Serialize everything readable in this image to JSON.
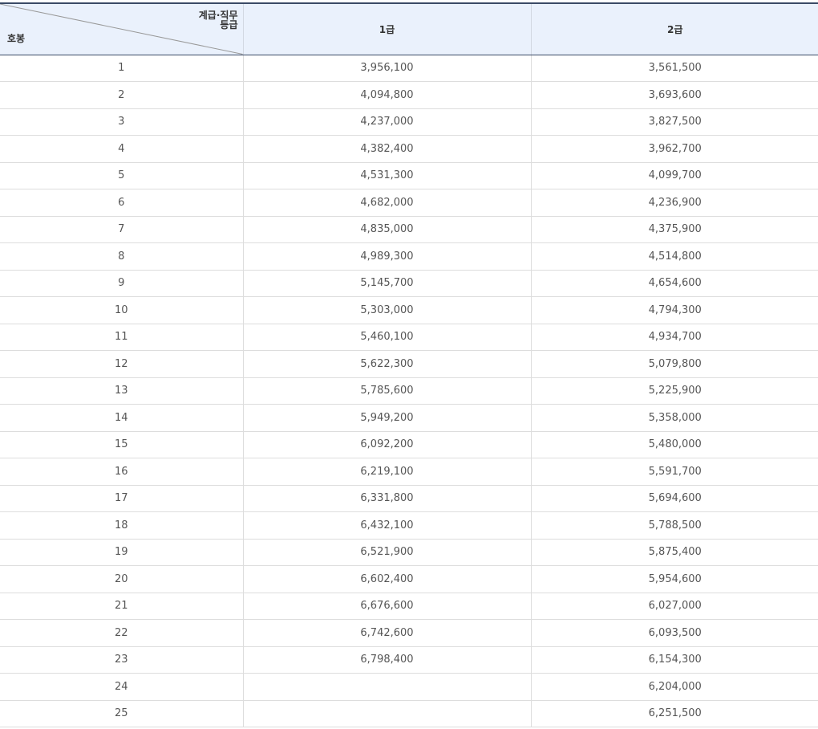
{
  "header": {
    "corner_top_line1": "계급·직무",
    "corner_top_line2": "등급",
    "corner_bottom": "호봉",
    "columns": [
      "1급",
      "2급"
    ]
  },
  "rows": [
    {
      "step": "1",
      "grade1": "3,956,100",
      "grade2": "3,561,500"
    },
    {
      "step": "2",
      "grade1": "4,094,800",
      "grade2": "3,693,600"
    },
    {
      "step": "3",
      "grade1": "4,237,000",
      "grade2": "3,827,500"
    },
    {
      "step": "4",
      "grade1": "4,382,400",
      "grade2": "3,962,700"
    },
    {
      "step": "5",
      "grade1": "4,531,300",
      "grade2": "4,099,700"
    },
    {
      "step": "6",
      "grade1": "4,682,000",
      "grade2": "4,236,900"
    },
    {
      "step": "7",
      "grade1": "4,835,000",
      "grade2": "4,375,900"
    },
    {
      "step": "8",
      "grade1": "4,989,300",
      "grade2": "4,514,800"
    },
    {
      "step": "9",
      "grade1": "5,145,700",
      "grade2": "4,654,600"
    },
    {
      "step": "10",
      "grade1": "5,303,000",
      "grade2": "4,794,300"
    },
    {
      "step": "11",
      "grade1": "5,460,100",
      "grade2": "4,934,700"
    },
    {
      "step": "12",
      "grade1": "5,622,300",
      "grade2": "5,079,800"
    },
    {
      "step": "13",
      "grade1": "5,785,600",
      "grade2": "5,225,900"
    },
    {
      "step": "14",
      "grade1": "5,949,200",
      "grade2": "5,358,000"
    },
    {
      "step": "15",
      "grade1": "6,092,200",
      "grade2": "5,480,000"
    },
    {
      "step": "16",
      "grade1": "6,219,100",
      "grade2": "5,591,700"
    },
    {
      "step": "17",
      "grade1": "6,331,800",
      "grade2": "5,694,600"
    },
    {
      "step": "18",
      "grade1": "6,432,100",
      "grade2": "5,788,500"
    },
    {
      "step": "19",
      "grade1": "6,521,900",
      "grade2": "5,875,400"
    },
    {
      "step": "20",
      "grade1": "6,602,400",
      "grade2": "5,954,600"
    },
    {
      "step": "21",
      "grade1": "6,676,600",
      "grade2": "6,027,000"
    },
    {
      "step": "22",
      "grade1": "6,742,600",
      "grade2": "6,093,500"
    },
    {
      "step": "23",
      "grade1": "6,798,400",
      "grade2": "6,154,300"
    },
    {
      "step": "24",
      "grade1": "",
      "grade2": "6,204,000"
    },
    {
      "step": "25",
      "grade1": "",
      "grade2": "6,251,500"
    }
  ]
}
